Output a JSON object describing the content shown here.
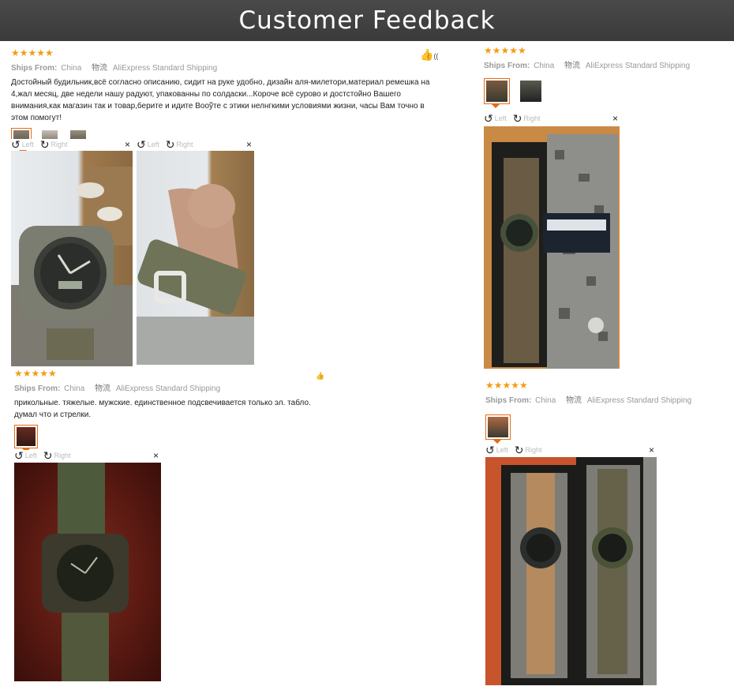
{
  "header": {
    "title": "Customer Feedback"
  },
  "common": {
    "ships_label": "Ships From:",
    "ships_value": "China",
    "shipping_cn": "物流",
    "shipping_method": "AliExpress Standard Shipping",
    "rotate_left": "Left",
    "rotate_right": "Right",
    "close": "×",
    "stars": "★★★★★"
  },
  "reviews": [
    {
      "rating": 5,
      "text": "Достойный будильник,всё согласно описанию, сидит на руке удобно, дизайн аля-милетори,материал ремешка на 4,жал месяц, две недели нашу радуют, упакованны по солдаски...Короче всё сурово и достстойно Вашего внимания,как магазин так и товар,берите и идите Вооўте с этики нелнгкими условиями жизни, часы Вам точно в этом помогут!",
      "like_count": "(("
    },
    {
      "rating": 5,
      "text": "прикольные. тяжелые. мужские. единственное подсвечивается только эл. табло. думал что и стрелки.",
      "like_count": ""
    },
    {
      "rating": 5
    },
    {
      "rating": 5
    }
  ],
  "colors": {
    "accent": "#e86b10",
    "star": "#f39c12",
    "banner": "#404040"
  }
}
